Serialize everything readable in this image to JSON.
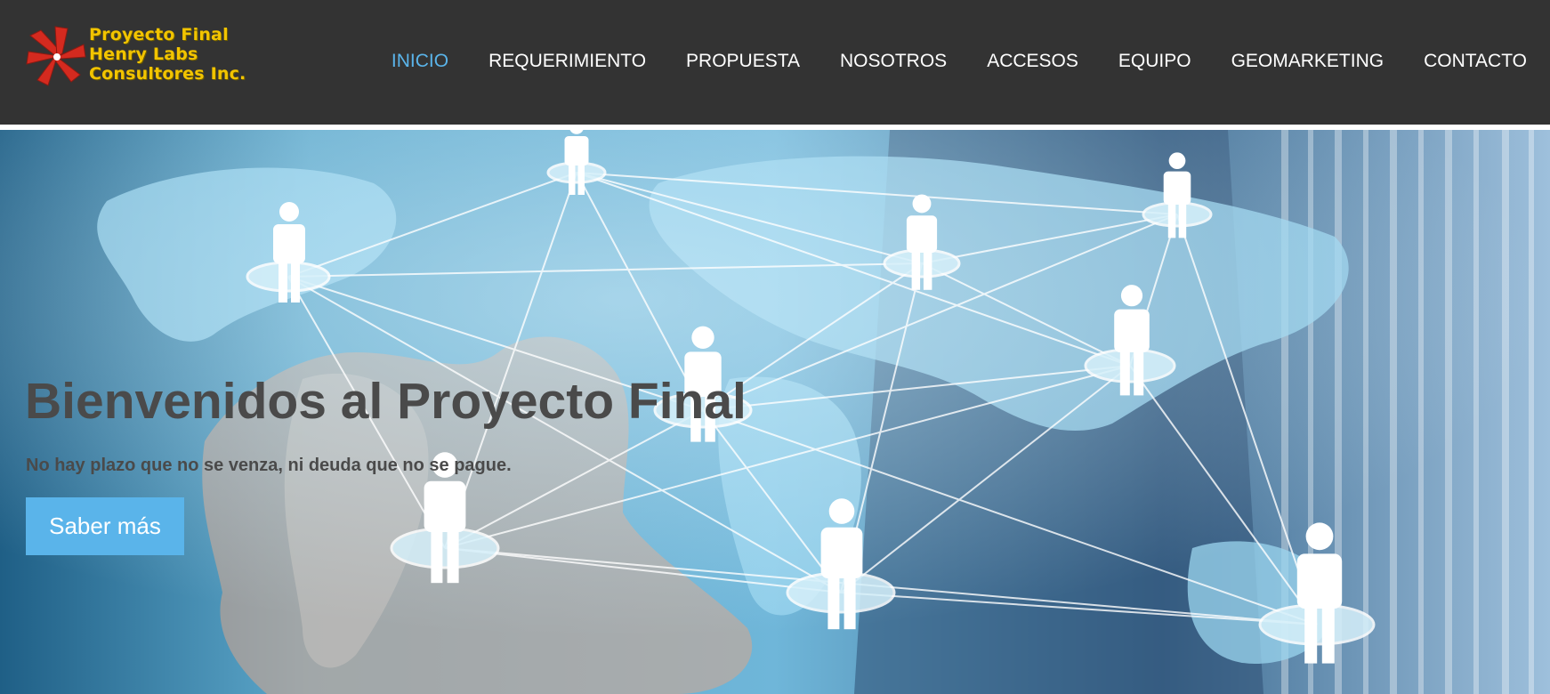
{
  "brand": {
    "lines": [
      "Proyecto Final",
      "Henry Labs",
      "Consultores Inc."
    ],
    "logo_icon": "pinwheel-logo-icon",
    "text_color": "#f2c400",
    "mark_color": "#d42a1f"
  },
  "nav": {
    "items": [
      {
        "label": "INICIO",
        "active": true
      },
      {
        "label": "REQUERIMIENTO",
        "active": false
      },
      {
        "label": "PROPUESTA",
        "active": false
      },
      {
        "label": "NOSOTROS",
        "active": false
      },
      {
        "label": "ACCESOS",
        "active": false
      },
      {
        "label": "EQUIPO",
        "active": false
      },
      {
        "label": "GEOMARKETING",
        "active": false
      },
      {
        "label": "CONTACTO",
        "active": false
      }
    ],
    "active_color": "#5ab4ea"
  },
  "hero": {
    "title": "Bienvenidos al Proyecto Final",
    "subtitle": "No hay plazo que no se venza, ni deuda que no se pague.",
    "button_label": "Saber más",
    "image_icon": "world-network-people-image",
    "accent": "#5ab4ea"
  }
}
